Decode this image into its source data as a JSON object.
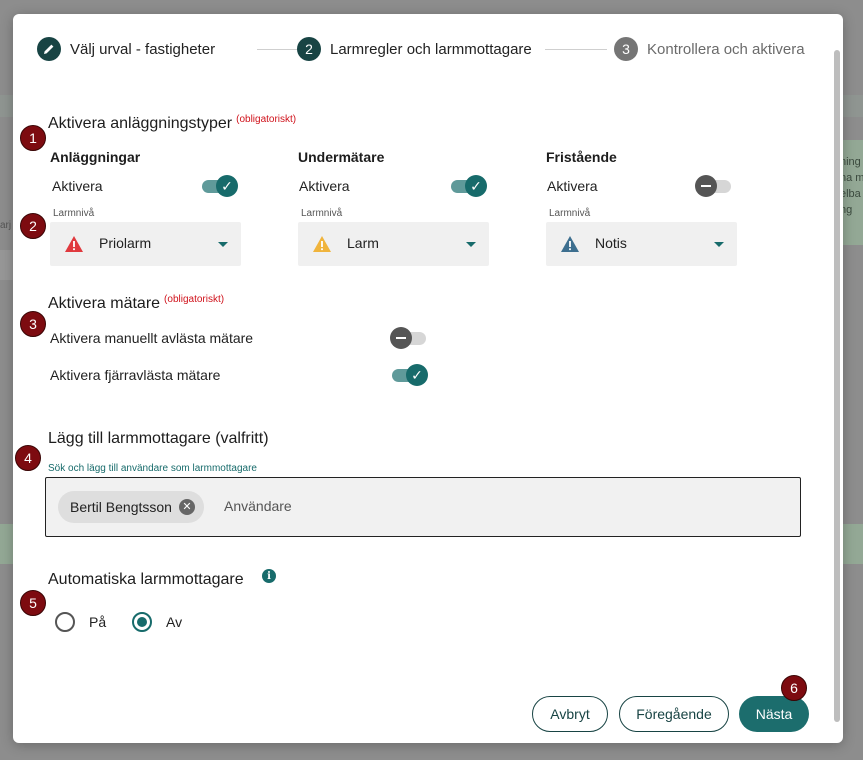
{
  "background": {
    "side_text": "ning\nna m\nelba\nng",
    "left_text": "arj"
  },
  "stepper": {
    "steps": [
      {
        "number": "",
        "icon": "pencil-icon",
        "label": "Välj urval - fastigheter",
        "state": "done"
      },
      {
        "number": "2",
        "label": "Larmregler och larmmottagare",
        "state": "active"
      },
      {
        "number": "3",
        "label": "Kontrollera och aktivera",
        "state": "inactive"
      }
    ]
  },
  "markers": [
    "1",
    "2",
    "3",
    "4",
    "5",
    "6"
  ],
  "facility_types": {
    "title": "Aktivera anläggningstyper",
    "required": "(obligatoriskt)",
    "columns": [
      {
        "heading": "Anläggningar",
        "toggle_label": "Aktivera",
        "enabled": true,
        "level_label": "Larmnivå",
        "level": "Priolarm",
        "level_icon": "warning-red-icon",
        "level_color": "#e0393e"
      },
      {
        "heading": "Undermätare",
        "toggle_label": "Aktivera",
        "enabled": true,
        "level_label": "Larmnivå",
        "level": "Larm",
        "level_icon": "warning-yellow-icon",
        "level_color": "#f0b43c"
      },
      {
        "heading": "Fristående",
        "toggle_label": "Aktivera",
        "enabled": false,
        "level_label": "Larmnivå",
        "level": "Notis",
        "level_icon": "warning-blue-icon",
        "level_color": "#3d6f8f"
      }
    ]
  },
  "meters": {
    "title": "Aktivera mätare",
    "required": "(obligatoriskt)",
    "items": [
      {
        "label": "Aktivera manuellt avlästa mätare",
        "enabled": false
      },
      {
        "label": "Aktivera fjärravlästa mätare",
        "enabled": true
      }
    ]
  },
  "recipients": {
    "title": "Lägg till larmmottagare (valfritt)",
    "hint": "Sök och lägg till användare som larmmottagare",
    "chips": [
      "Bertil Bengtsson"
    ],
    "placeholder": "Användare"
  },
  "auto_recipients": {
    "title": "Automatiska larmmottagare",
    "options": [
      {
        "label": "På",
        "checked": false
      },
      {
        "label": "Av",
        "checked": true
      }
    ]
  },
  "buttons": {
    "cancel": "Avbryt",
    "previous": "Föregående",
    "next": "Nästa"
  },
  "colors": {
    "accent": "#176b6b",
    "dark": "#184444",
    "required": "#d0121b",
    "marker": "#7d0b10"
  }
}
